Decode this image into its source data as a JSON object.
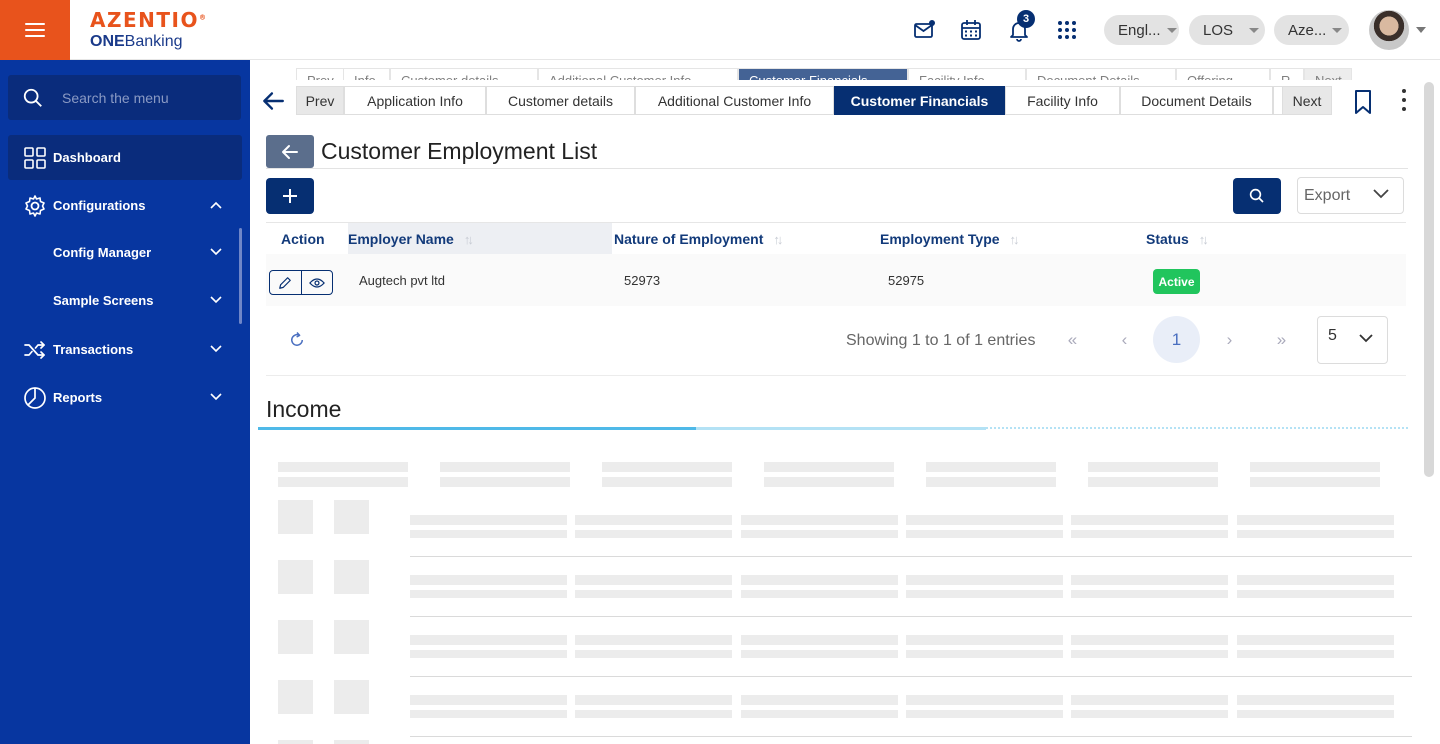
{
  "header": {
    "logo_brand": "AZENTIO",
    "logo_sub_bold": "ONE",
    "logo_sub_rest": "Banking",
    "notification_count": "3",
    "language_pill": "Engl...",
    "module_pill": "LOS",
    "entity_pill": "Aze...",
    "icons": [
      "hamburger-icon",
      "mail-icon",
      "calendar-icon",
      "bell-icon",
      "apps-grid-icon",
      "avatar",
      "chevron-down-icon"
    ]
  },
  "sidebar": {
    "search_placeholder": "Search the menu",
    "items": [
      {
        "label": "Dashboard",
        "icon": "dashboard-grid-icon",
        "active": true
      },
      {
        "label": "Configurations",
        "icon": "gear-icon",
        "expanded": true
      },
      {
        "label": "Config Manager",
        "sub": true
      },
      {
        "label": "Sample Screens",
        "sub": true
      },
      {
        "label": "Transactions",
        "icon": "shuffle-icon"
      },
      {
        "label": "Reports",
        "icon": "pie-chart-icon"
      }
    ],
    "colors": {
      "bg": "#0736a0",
      "accent": "#0a2c7c"
    }
  },
  "tabs": {
    "prev": "Prev",
    "next": "Next",
    "items": [
      "Application Info",
      "Customer details",
      "Additional Customer Info",
      "Customer Financials",
      "Facility Info",
      "Document Details"
    ],
    "active": "Customer Financials",
    "ghost_items": [
      "Prev",
      "Info",
      "Customer details",
      "Additional Customer Info",
      "Customer Financials",
      "Facility Info",
      "Document Details",
      "Offering",
      "R...",
      "Next"
    ]
  },
  "employment": {
    "title": "Customer Employment List",
    "export_label": "Export",
    "columns": [
      "Action",
      "Employer Name",
      "Nature of Employment",
      "Employment Type",
      "Status"
    ],
    "rows": [
      {
        "employer": "Augtech pvt ltd",
        "nature": "52973",
        "type": "52975",
        "status": "Active"
      }
    ],
    "pagination": {
      "info": "Showing 1 to 1 of 1 entries",
      "current_page": "1",
      "page_size": "5",
      "first": "«",
      "prev": "‹",
      "next": "›",
      "last": "»"
    }
  },
  "income": {
    "title": "Income"
  },
  "colors": {
    "primary": "#062f72",
    "brand_orange": "#e8531c",
    "status_active": "#21c55d"
  }
}
